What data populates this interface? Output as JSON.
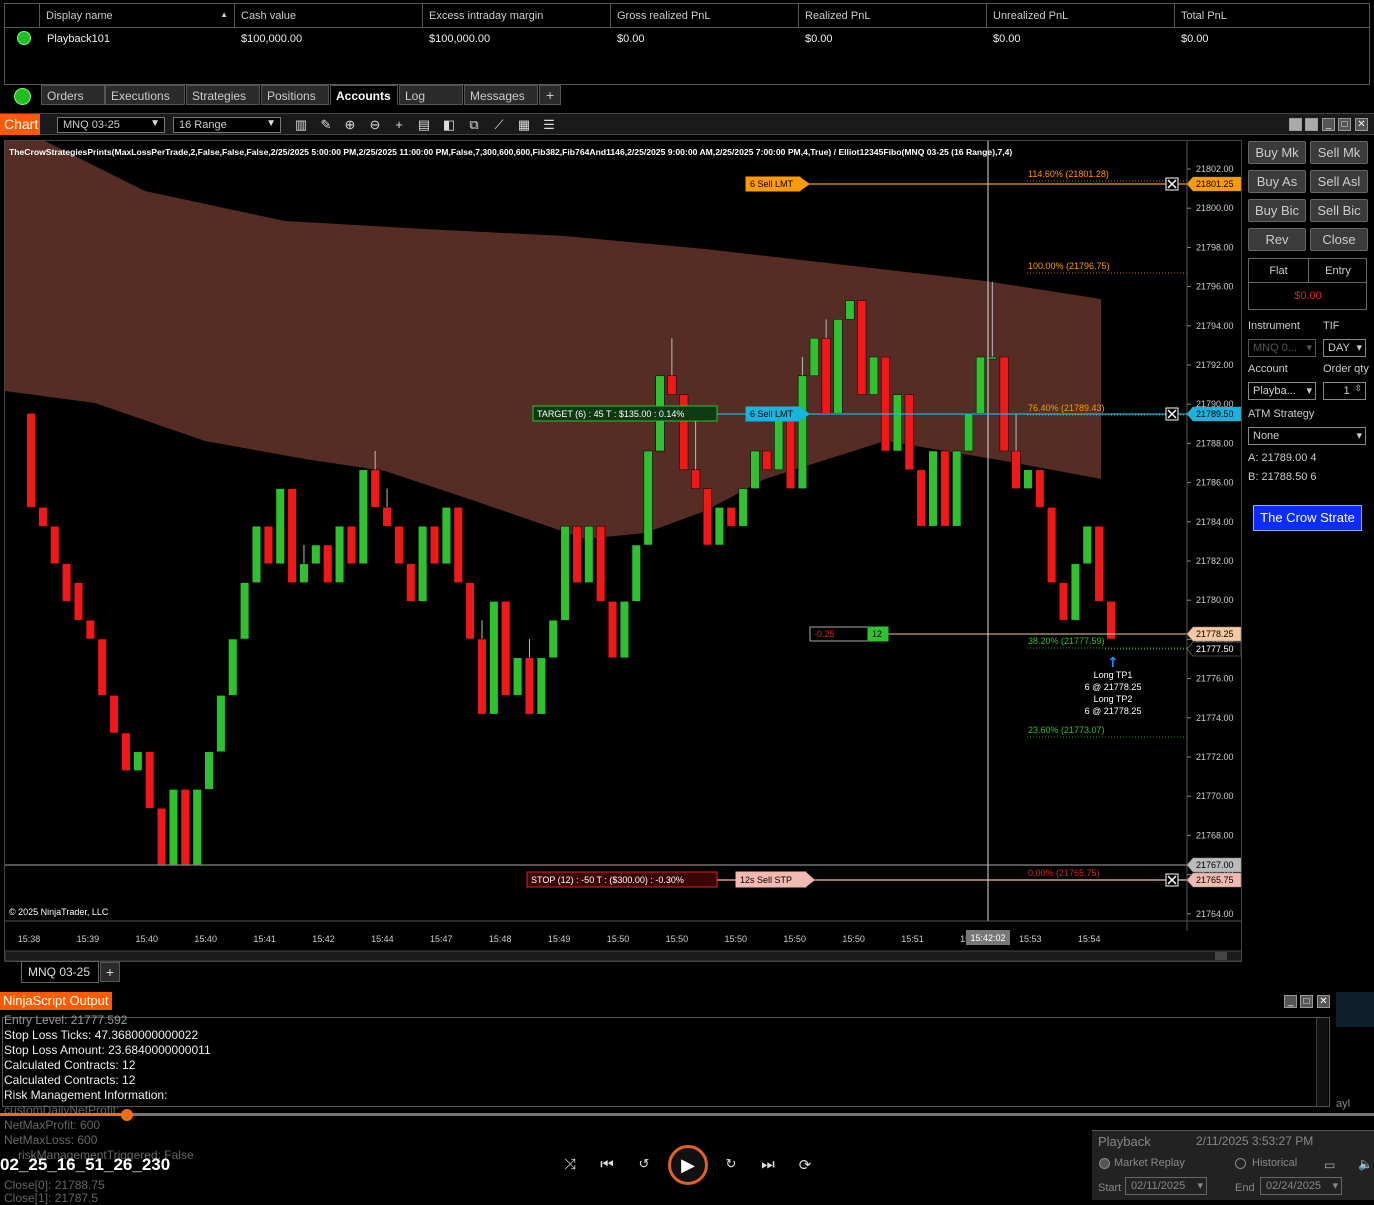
{
  "accounts": {
    "headers": [
      "Display name",
      "Cash value",
      "Excess intraday margin",
      "Gross realized PnL",
      "Realized PnL",
      "Unrealized PnL",
      "Total PnL"
    ],
    "row": [
      "Playback101",
      "$100,000.00",
      "$100,000.00",
      "$0.00",
      "$0.00",
      "$0.00",
      "$0.00"
    ],
    "sort_indicator": "▲"
  },
  "tabs": [
    "Orders",
    "Executions",
    "Strategies",
    "Positions",
    "Accounts",
    "Log",
    "Messages",
    "+"
  ],
  "active_tab": "Accounts",
  "chart": {
    "tab_label": "Chart",
    "instrument": "MNQ 03-25",
    "bar_type": "16 Range",
    "indicator_label": "TheCrowStrategiesPrints(MaxLossPerTrade,2,False,False,False,2/25/2025 5:00:00 PM,2/25/2025 11:00:00 PM,False,7,300,600,600,Fib382,Fib764And1146,2/25/2025 9:00:00 AM,2/25/2025 7:00:00 PM,4,True) / Elliot12345Fibo(MNQ 03-25 (16 Range),7,4)",
    "copyright": "© 2025 NinjaTrader, LLC",
    "bottom_tab": "MNQ 03-25",
    "crosshair_time": "15:42:02",
    "time_labels": [
      "15:38",
      "15:39",
      "15:40",
      "15:40",
      "15:41",
      "15:42",
      "15:44",
      "15:47",
      "15:48",
      "15:49",
      "15:50",
      "15:50",
      "15:50",
      "15:50",
      "15:50",
      "15:51",
      "15:52",
      "15:53",
      "15:54"
    ],
    "price_labels": [
      "21802.00",
      "21800.00",
      "21798.00",
      "21796.00",
      "21794.00",
      "21792.00",
      "21790.00",
      "21788.00",
      "21786.00",
      "21784.00",
      "21782.00",
      "21780.00",
      "21778.00",
      "21776.00",
      "21774.00",
      "21772.00",
      "21770.00",
      "21768.00",
      "21766.00",
      "21764.00"
    ],
    "price_tags": {
      "sell_lmt_top": "21801.25",
      "sell_lmt_mid": "21789.50",
      "last": "21778.25",
      "bid": "21777.50",
      "low": "21767.00",
      "stop": "21765.75"
    },
    "fib_levels": [
      "114.60% (21801.28)",
      "100.00% (21796.75)",
      "76.40% (21789.43)",
      "38.20% (21777.59)",
      "23.60% (21773.07)",
      "0.00% (21765.75)"
    ],
    "orders": {
      "sell_lmt_1": {
        "qty": "6",
        "label": "Sell LMT"
      },
      "sell_lmt_2": {
        "qty": "6",
        "label": "Sell LMT"
      },
      "target": "TARGET (6)  :  45 T  :  $135.00  :  0.14%",
      "stop": "STOP (12)  :  -50 T  :  ($300.00)  :  -0.30%",
      "stop_order": "12s  Sell STP",
      "position_pnl": "-0.25",
      "position_qty": "12"
    },
    "annotations": [
      "Long TP1",
      "6 @ 21778.25",
      "Long TP2",
      "6 @ 21778.25"
    ],
    "chart_data": {
      "type": "candlestick",
      "ylim": [
        21763,
        21803
      ],
      "candles": [
        [
          21790,
          21790,
          21785,
          21785
        ],
        [
          21785,
          21785,
          21784,
          21784
        ],
        [
          21784,
          21784,
          21782,
          21782
        ],
        [
          21782,
          21782,
          21780,
          21780
        ],
        [
          21781,
          21781,
          21779,
          21779
        ],
        [
          21779,
          21779,
          21778,
          21778
        ],
        [
          21778,
          21778,
          21775,
          21775
        ],
        [
          21775,
          21775,
          21773,
          21773
        ],
        [
          21773,
          21773,
          21771,
          21771
        ],
        [
          21771,
          21772,
          21771,
          21772
        ],
        [
          21772,
          21772,
          21769,
          21769
        ],
        [
          21769,
          21769,
          21766,
          21766
        ],
        [
          21766,
          21770,
          21766,
          21770
        ],
        [
          21770,
          21770,
          21766,
          21766
        ],
        [
          21766,
          21770,
          21766,
          21770
        ],
        [
          21770,
          21772,
          21770,
          21772
        ],
        [
          21772,
          21775,
          21772,
          21775
        ],
        [
          21775,
          21778,
          21775,
          21778
        ],
        [
          21778,
          21781,
          21778,
          21781
        ],
        [
          21781,
          21784,
          21781,
          21784
        ],
        [
          21784,
          21784,
          21782,
          21782
        ],
        [
          21782,
          21786,
          21782,
          21786
        ],
        [
          21786,
          21786,
          21781,
          21781
        ],
        [
          21781,
          21783,
          21781,
          21782
        ],
        [
          21782,
          21783,
          21782,
          21783
        ],
        [
          21783,
          21783,
          21781,
          21781
        ],
        [
          21781,
          21784,
          21781,
          21784
        ],
        [
          21784,
          21784,
          21782,
          21782
        ],
        [
          21782,
          21787,
          21782,
          21787
        ],
        [
          21787,
          21788,
          21785,
          21785
        ],
        [
          21785,
          21786,
          21784,
          21784
        ],
        [
          21784,
          21784,
          21782,
          21782
        ],
        [
          21782,
          21780,
          21780,
          21780
        ],
        [
          21780,
          21784,
          21780,
          21784
        ],
        [
          21784,
          21784,
          21782,
          21782
        ],
        [
          21782,
          21785,
          21782,
          21785
        ],
        [
          21785,
          21785,
          21781,
          21781
        ],
        [
          21781,
          21781,
          21778,
          21778
        ],
        [
          21778,
          21779,
          21774,
          21774
        ],
        [
          21774,
          21780,
          21774,
          21780
        ],
        [
          21780,
          21780,
          21775,
          21775
        ],
        [
          21775,
          21777,
          21775,
          21777
        ],
        [
          21777,
          21778,
          21774,
          21774
        ],
        [
          21774,
          21777,
          21774,
          21777
        ],
        [
          21777,
          21779,
          21777,
          21779
        ],
        [
          21779,
          21784,
          21779,
          21784
        ],
        [
          21784,
          21784,
          21781,
          21781
        ],
        [
          21781,
          21784,
          21781,
          21784
        ],
        [
          21784,
          21784,
          21780,
          21780
        ],
        [
          21780,
          21780,
          21777,
          21777
        ],
        [
          21777,
          21780,
          21777,
          21780
        ],
        [
          21780,
          21783,
          21780,
          21783
        ],
        [
          21783,
          21788,
          21783,
          21788
        ],
        [
          21788,
          21792,
          21788,
          21792
        ],
        [
          21792,
          21794,
          21791,
          21791
        ],
        [
          21791,
          21791,
          21787,
          21787
        ],
        [
          21787,
          21790,
          21787,
          21786
        ],
        [
          21786,
          21786,
          21783,
          21783
        ],
        [
          21783,
          21785,
          21783,
          21785
        ],
        [
          21785,
          21785,
          21784,
          21784
        ],
        [
          21784,
          21786,
          21784,
          21786
        ],
        [
          21786,
          21788,
          21786,
          21788
        ],
        [
          21788,
          21788,
          21787,
          21787
        ],
        [
          21787,
          21790,
          21787,
          21790
        ],
        [
          21790,
          21790,
          21786,
          21786
        ],
        [
          21786,
          21793,
          21786,
          21792
        ],
        [
          21792,
          21794,
          21792,
          21794
        ],
        [
          21794,
          21795,
          21790,
          21790
        ],
        [
          21790,
          21795,
          21790,
          21795
        ],
        [
          21795,
          21796,
          21795,
          21796
        ],
        [
          21796,
          21796,
          21791,
          21791
        ],
        [
          21791,
          21793,
          21791,
          21793
        ],
        [
          21793,
          21793,
          21788,
          21788
        ],
        [
          21788,
          21791,
          21788,
          21791
        ],
        [
          21791,
          21791,
          21787,
          21787
        ],
        [
          21787,
          21787,
          21784,
          21784
        ],
        [
          21784,
          21788,
          21784,
          21788
        ],
        [
          21788,
          21788,
          21784,
          21784
        ],
        [
          21784,
          21788,
          21784,
          21788
        ],
        [
          21788,
          21790,
          21788,
          21790
        ],
        [
          21790,
          21792,
          21790,
          21793
        ],
        [
          21793,
          21797,
          21793,
          21793
        ],
        [
          21793,
          21793,
          21788,
          21788
        ],
        [
          21788,
          21790,
          21788,
          21786
        ],
        [
          21786,
          21787,
          21786,
          21787
        ],
        [
          21787,
          21787,
          21785,
          21785
        ],
        [
          21785,
          21785,
          21781,
          21781
        ],
        [
          21781,
          21781,
          21779,
          21779
        ],
        [
          21779,
          21782,
          21779,
          21782
        ],
        [
          21782,
          21784,
          21782,
          21784
        ],
        [
          21784,
          21784,
          21780,
          21780
        ],
        [
          21780,
          21780,
          21778,
          21778
        ]
      ]
    }
  },
  "trade_panel": {
    "buttons": [
      "Buy Mk",
      "Sell Mk",
      "Buy As",
      "Sell Asl",
      "Buy Bic",
      "Sell Bic",
      "Rev",
      "Close"
    ],
    "flat_label": "Flat",
    "entry_label": "Entry",
    "pnl": "$0.00",
    "instrument_label": "Instrument",
    "tif_label": "TIF",
    "instrument_value": "MNQ 0...",
    "tif_value": "DAY",
    "account_label": "Account",
    "order_qty_label": "Order qty",
    "account_value": "Playba...",
    "order_qty_value": "1",
    "atm_label": "ATM Strategy",
    "atm_value": "None",
    "ask": "A:  21789.00   4",
    "bid": "B:  21788.50   6",
    "strategy_button": "The Crow Strate"
  },
  "ninjascript": {
    "title": "NinjaScript Output",
    "lines": [
      "Entry Level: 21777.592",
      "Stop Loss Ticks: 47.3680000000022",
      "Stop Loss Amount: 23.6840000000011",
      "Calculated Contracts: 12",
      "Calculated Contracts: 12",
      "Risk Management Information:"
    ],
    "dim_lines": [
      "customDailyNetProfit: ...",
      "NetMaxProfit: 600",
      "NetMaxLoss: 600",
      "riskManagementTriggered: False",
      "Close[0]: 21788.75",
      "Close[1]: 21787.5"
    ]
  },
  "player": {
    "filename": "02_25_16_51_26_230",
    "side_text": "ayl"
  },
  "playback": {
    "title": "Playback",
    "datetime": "2/11/2025 3:53:27 PM",
    "market_replay": "Market Replay",
    "historical": "Historical",
    "start_label": "Start",
    "start_value": "02/11/2025",
    "end_label": "End",
    "end_value": "02/24/2025"
  },
  "colors": {
    "accent": "#ff5a00",
    "up": "#2fc12f",
    "down": "#f01818",
    "band": "#5a2f27",
    "target_line": "#18b4e0",
    "stop_line": "#f2b9b0",
    "order_line": "#ff9a00",
    "strategy_button": "#0b2cff"
  }
}
